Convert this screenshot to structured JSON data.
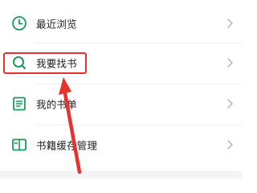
{
  "menu": {
    "items": [
      {
        "label": "最近浏览",
        "icon": "clock-icon"
      },
      {
        "label": "我要找书",
        "icon": "search-icon"
      },
      {
        "label": "我的书单",
        "icon": "booklist-icon"
      },
      {
        "label": "书籍缓存管理",
        "icon": "book-cache-icon"
      }
    ],
    "chevron_icon": "chevron-right-icon"
  },
  "colors": {
    "accent": "#1a9b5e",
    "annotation": "#e8322e",
    "text": "#222222",
    "chevron": "#b5b5b5"
  }
}
